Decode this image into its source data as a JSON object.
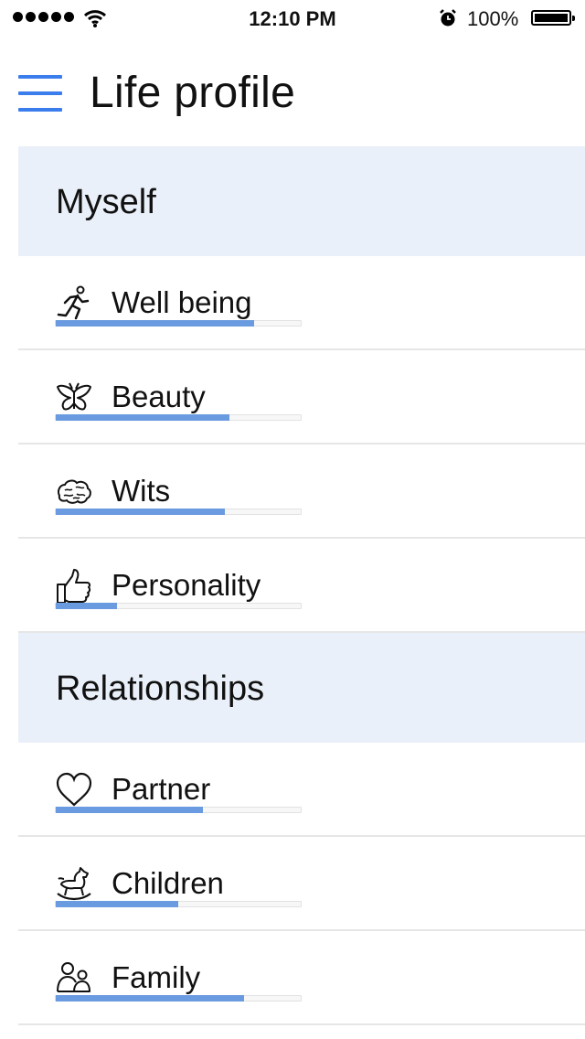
{
  "status_bar": {
    "time": "12:10 PM",
    "battery_percent": "100%",
    "icons": [
      "signal-dots-icon",
      "wifi-icon",
      "alarm-icon",
      "battery-icon"
    ]
  },
  "header": {
    "menu_icon": "hamburger-menu-icon",
    "title": "Life profile"
  },
  "colors": {
    "accent": "#3b7ded",
    "section_bg": "#eaf0f9",
    "progress_fill": "#6a9ae0",
    "divider": "#e6e6e6"
  },
  "sections": [
    {
      "label": "Myself",
      "items": [
        {
          "label": "Well being",
          "icon": "running-person-icon",
          "progress": 0.81
        },
        {
          "label": "Beauty",
          "icon": "butterfly-icon",
          "progress": 0.71
        },
        {
          "label": "Wits",
          "icon": "brain-icon",
          "progress": 0.69
        },
        {
          "label": "Personality",
          "icon": "thumbs-up-icon",
          "progress": 0.25
        }
      ]
    },
    {
      "label": "Relationships",
      "items": [
        {
          "label": "Partner",
          "icon": "heart-icon",
          "progress": 0.6
        },
        {
          "label": "Children",
          "icon": "rocking-horse-icon",
          "progress": 0.5
        },
        {
          "label": "Family",
          "icon": "family-icon",
          "progress": 0.77
        }
      ]
    }
  ]
}
